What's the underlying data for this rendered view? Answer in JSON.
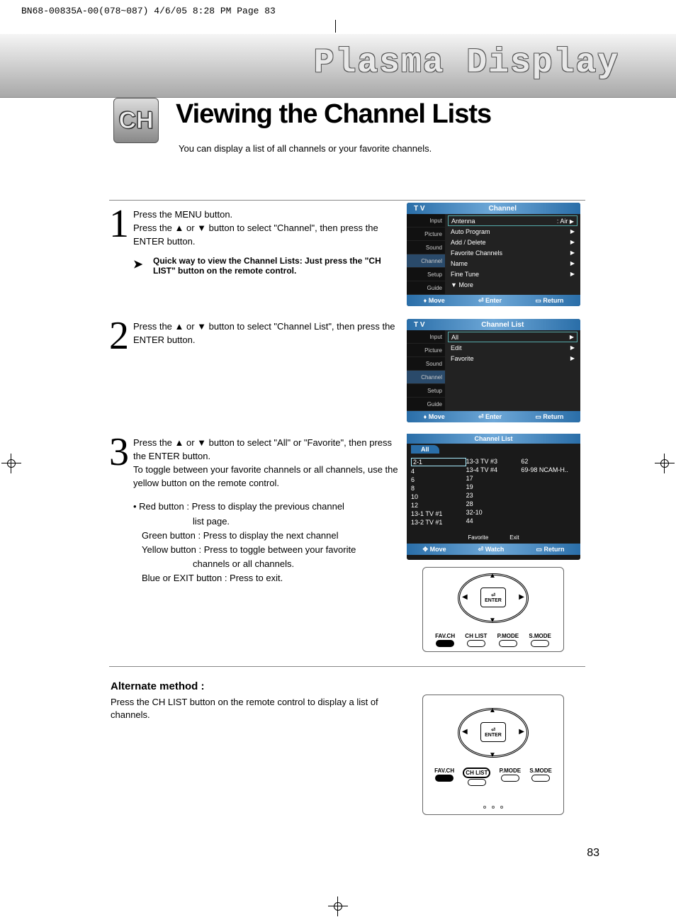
{
  "header_line": "BN68-00835A-00(078~087)  4/6/05  8:28 PM  Page 83",
  "banner_title": "Plasma Display",
  "ch_badge": "CH",
  "main_title": "Viewing the Channel Lists",
  "subtitle": "You can display a list of all channels or your favorite channels.",
  "steps": {
    "s1": {
      "num": "1",
      "line1": "Press the MENU button.",
      "line2": "Press the ▲ or ▼ button to select \"Channel\", then press the ENTER button.",
      "tip": "Quick way to view the Channel Lists: Just press the \"CH LIST\" button on the remote control."
    },
    "s2": {
      "num": "2",
      "body": "Press the ▲ or ▼ button to select \"Channel List\", then press the ENTER button."
    },
    "s3": {
      "num": "3",
      "p1": "Press the ▲ or ▼ button to select \"All\" or \"Favorite\", then press the ENTER button.",
      "p2": "To toggle between your favorite channels or all channels, use the yellow button on the remote control.",
      "b1a": "• Red button : Press to display the previous channel",
      "b1b": "list page.",
      "b2": "Green button : Press to display the next channel",
      "b3a": "Yellow button : Press to toggle between your favorite",
      "b3b": "channels or all channels.",
      "b4": "Blue or EXIT button : Press to exit."
    }
  },
  "alt_title": "Alternate method :",
  "alt_body": "Press the CH LIST button on the remote control to display a list of channels.",
  "page_number": "83",
  "osd": {
    "tv": "T V",
    "side": [
      "Input",
      "Picture",
      "Sound",
      "Channel",
      "Setup",
      "Guide"
    ],
    "panel1": {
      "title": "Channel",
      "rows": [
        {
          "label": "Antenna",
          "value": ": Air"
        },
        {
          "label": "Auto Program",
          "value": ""
        },
        {
          "label": "Add / Delete",
          "value": ""
        },
        {
          "label": "Favorite Channels",
          "value": ""
        },
        {
          "label": "Name",
          "value": ""
        },
        {
          "label": "Fine Tune",
          "value": ""
        },
        {
          "label": "▼ More",
          "value": "",
          "nocaret": true
        }
      ]
    },
    "panel2": {
      "title": "Channel List",
      "rows": [
        {
          "label": "All",
          "value": ""
        },
        {
          "label": "Edit",
          "value": ""
        },
        {
          "label": "Favorite",
          "value": ""
        }
      ]
    },
    "footer": {
      "move": "Move",
      "enter": "Enter",
      "return": "Return"
    }
  },
  "chlist": {
    "title": "Channel List",
    "tab": "All",
    "col1": [
      "2-1",
      "4",
      "6",
      "8",
      "10",
      "12",
      "13-1 TV #1",
      "13-2 TV #1"
    ],
    "col2": [
      "13-3 TV #3",
      "13-4 TV #4",
      "17",
      "19",
      "23",
      "28",
      "32-10",
      "44"
    ],
    "col3": [
      "62",
      "69-98 NCAM-H.."
    ],
    "icons": {
      "fav": "Favorite",
      "exit": "Exit"
    },
    "footer": {
      "move": "Move",
      "watch": "Watch",
      "return": "Return"
    }
  },
  "remote": {
    "enter": "ENTER",
    "buttons": [
      "FAV.CH",
      "CH LIST",
      "P.MODE",
      "S.MODE"
    ]
  }
}
